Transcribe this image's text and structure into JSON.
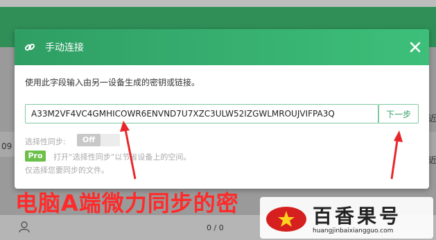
{
  "background": {
    "side_texts": [
      "09",
      "近",
      "近"
    ],
    "count": "0 / 0"
  },
  "modal": {
    "title": "手动连接",
    "description": "使用此字段输入由另一设备生成的密钥或链接。",
    "key_value": "A33M2VF4VC4GMHICOWR6ENVND7U7XZC3ULW52IZGWLMROUJVIFPA3Q",
    "next_label": "下一步",
    "selective_sync_label": "选择性同步:",
    "toggle_label": "Off",
    "pro_badge": "Pro",
    "pro_text": "打开“选择性同步”以节省设备上的空间。",
    "hint": "仅选择您要同步的文件。"
  },
  "annotation": {
    "caption": "电脑A端微力同步的密",
    "color": "#ff2a2a"
  },
  "watermark": {
    "title": "百香果号",
    "url": "huangjinbaixiangguo.com"
  },
  "colors": {
    "header_green": "#2f9e63",
    "accent_green": "#6cc04a"
  }
}
